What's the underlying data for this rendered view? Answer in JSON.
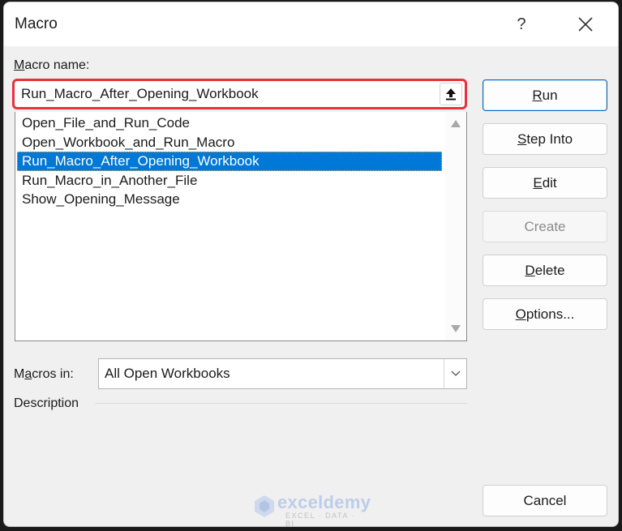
{
  "window": {
    "title": "Macro",
    "help_label": "?",
    "close_icon": "close-icon"
  },
  "macro_name": {
    "label_accel": "M",
    "label_rest": "acro name:",
    "value": "Run_Macro_After_Opening_Workbook",
    "upload_icon": "arrow-up-bar-icon"
  },
  "macro_list": {
    "items": [
      "Open_File_and_Run_Code",
      "Open_Workbook_and_Run_Macro",
      "Run_Macro_After_Opening_Workbook",
      "Run_Macro_in_Another_File",
      "Show_Opening_Message"
    ],
    "selected_index": 2
  },
  "buttons": {
    "run": {
      "accel": "R",
      "rest": "un"
    },
    "step_into": {
      "accel": "S",
      "rest": "tep Into"
    },
    "edit": {
      "accel": "E",
      "rest": "dit"
    },
    "create": {
      "label": "Create",
      "disabled": true
    },
    "delete": {
      "accel": "D",
      "rest": "elete"
    },
    "options": {
      "accel": "O",
      "rest": "ptions..."
    },
    "cancel": {
      "label": "Cancel"
    }
  },
  "macros_in": {
    "label_pre": "M",
    "label_accel": "a",
    "label_rest": "cros in:",
    "value": "All Open Workbooks"
  },
  "description": {
    "label": "Description"
  },
  "watermark": {
    "brand": "exceldemy",
    "tagline": "EXCEL · DATA · BI"
  },
  "colors": {
    "selection": "#0078d7",
    "highlight_border": "#e8323c",
    "default_button_border": "#0067c0"
  }
}
